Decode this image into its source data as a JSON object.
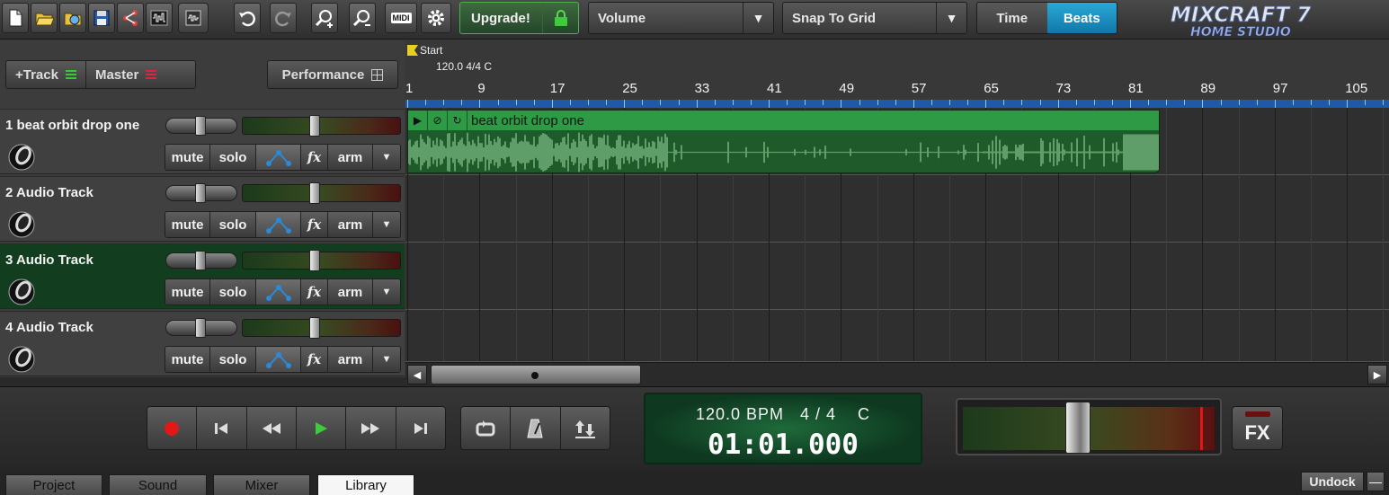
{
  "toolbar": {
    "icons": [
      "new-file-icon",
      "open-folder-icon",
      "open-project-icon",
      "save-icon",
      "share-icon",
      "import-audio-icon",
      "undo-icon",
      "redo-icon",
      "zoom-in-icon",
      "zoom-out-icon",
      "midi-icon",
      "settings-icon"
    ],
    "midi_label": "MIDI",
    "upgrade_label": "Upgrade!",
    "volume_label": "Volume",
    "snap_label": "Snap To Grid",
    "time_label": "Time",
    "beats_label": "Beats",
    "logo_line1": "mixcraft 7",
    "logo_line2": "HOME STUDIO"
  },
  "track_panel": {
    "add_track_label": "+Track",
    "master_label": "Master",
    "performance_label": "Performance"
  },
  "tracks": [
    {
      "name": "1 beat orbit drop one",
      "mute": "mute",
      "solo": "solo",
      "fx": "fx",
      "arm": "arm",
      "more": "▼",
      "selected": false
    },
    {
      "name": "2 Audio Track",
      "mute": "mute",
      "solo": "solo",
      "fx": "fx",
      "arm": "arm",
      "more": "▼",
      "selected": false
    },
    {
      "name": "3 Audio Track",
      "mute": "mute",
      "solo": "solo",
      "fx": "fx",
      "arm": "arm",
      "more": "▼",
      "selected": true
    },
    {
      "name": "4 Audio Track",
      "mute": "mute",
      "solo": "solo",
      "fx": "fx",
      "arm": "arm",
      "more": "▼",
      "selected": false
    }
  ],
  "timeline": {
    "start_label": "Start",
    "tempo_label": "120.0 4/4 C",
    "bar_numbers": [
      "1",
      "9",
      "17",
      "25",
      "33",
      "41",
      "49",
      "57",
      "65",
      "73",
      "81",
      "89",
      "97",
      "105"
    ],
    "clip_title": "beat orbit drop one"
  },
  "transport": {
    "bpm_line": "120.0 BPM   4 / 4    C",
    "position": "01:01.000",
    "fx_label": "FX"
  },
  "tabs": [
    "Project",
    "Sound",
    "Mixer",
    "Library"
  ],
  "active_tab": "Library",
  "undock_label": "Undock",
  "colors": {
    "accent": "#1a8fc8",
    "clip": "#2e9a45",
    "selected_track": "#133d1f",
    "record": "#e01818",
    "play": "#3ccc3c"
  }
}
